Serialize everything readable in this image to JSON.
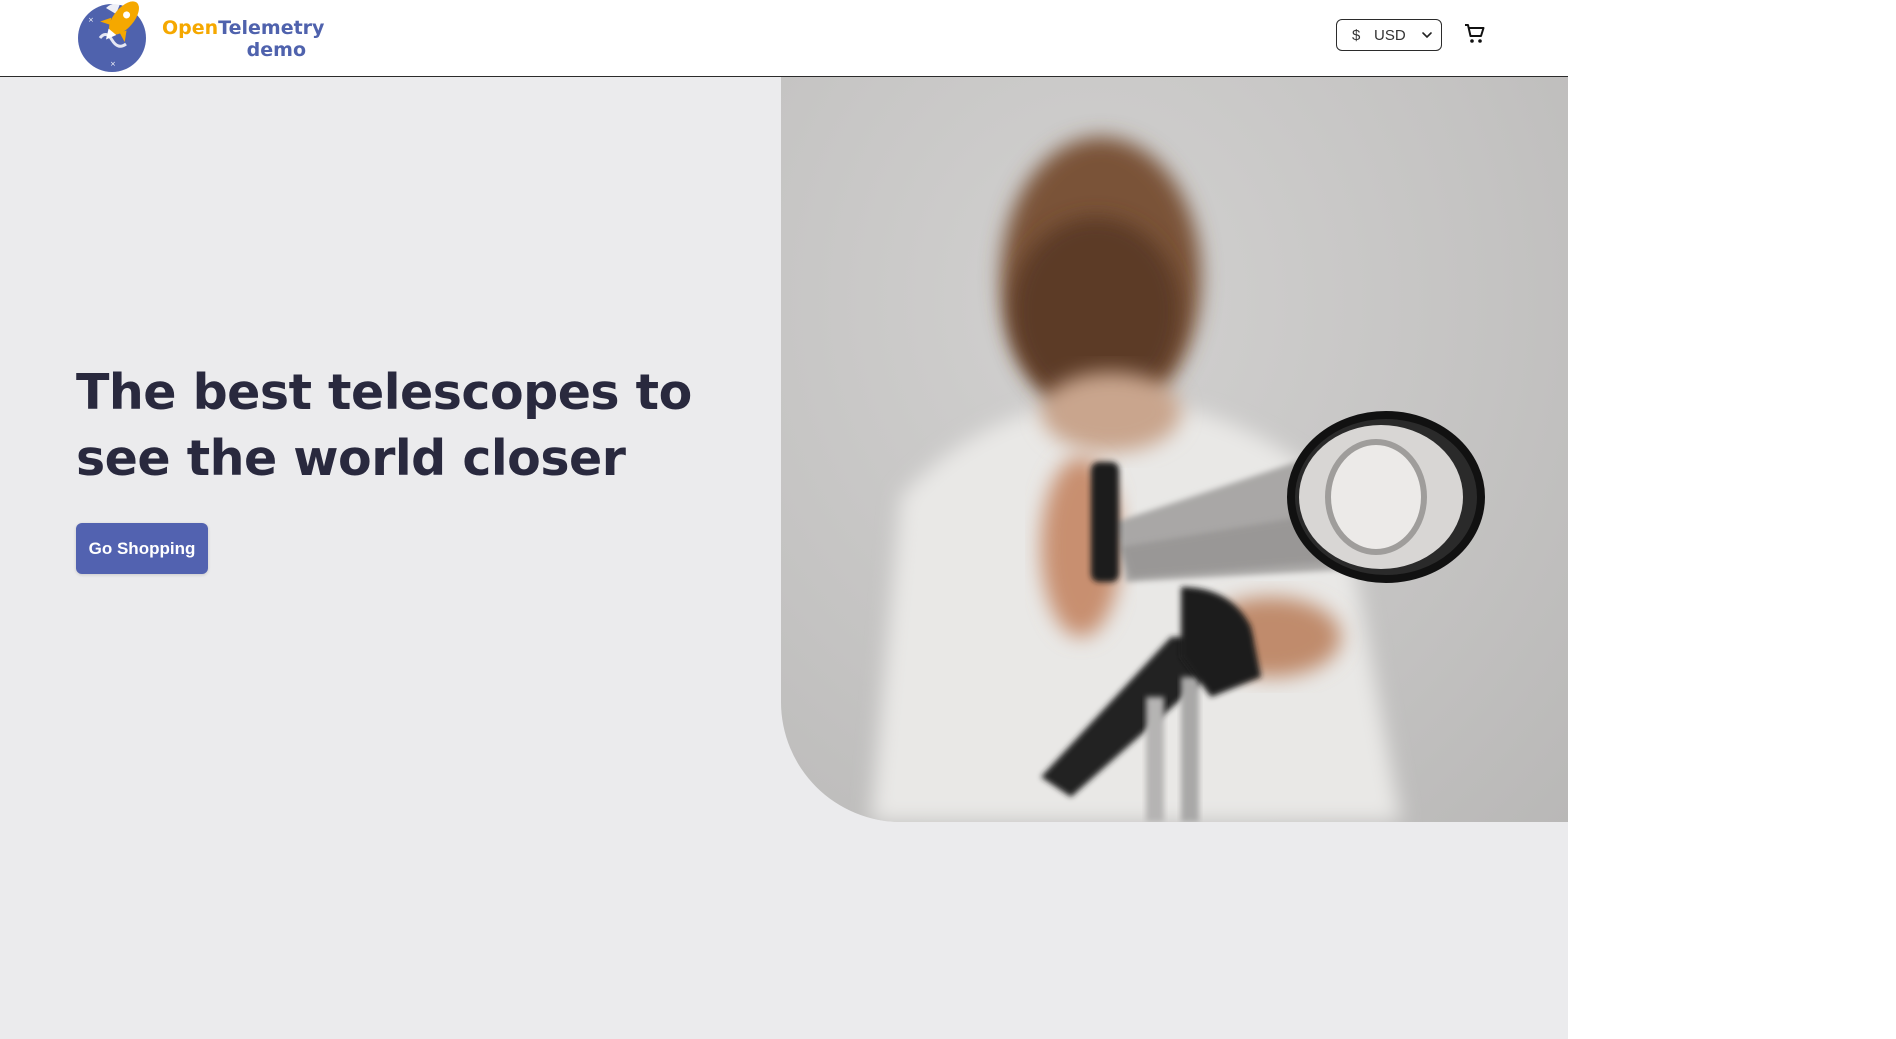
{
  "header": {
    "logo": {
      "word_open": "Open",
      "word_telemetry": "Telemetry",
      "word_demo": "demo"
    },
    "currency": {
      "symbol": "$",
      "code": "USD",
      "icon": "chevron-down-icon"
    },
    "cart": {
      "icon": "shopping-cart-icon"
    }
  },
  "hero": {
    "title": "The best telescopes to see the world closer",
    "cta_label": "Go Shopping",
    "image_alt": "Child looking through a telescope"
  },
  "colors": {
    "brand_blue": "#4f62ad",
    "brand_orange": "#f5a800",
    "cta_bg": "#5262b0",
    "title_text": "#29293e",
    "page_bg": "#ebebed"
  }
}
